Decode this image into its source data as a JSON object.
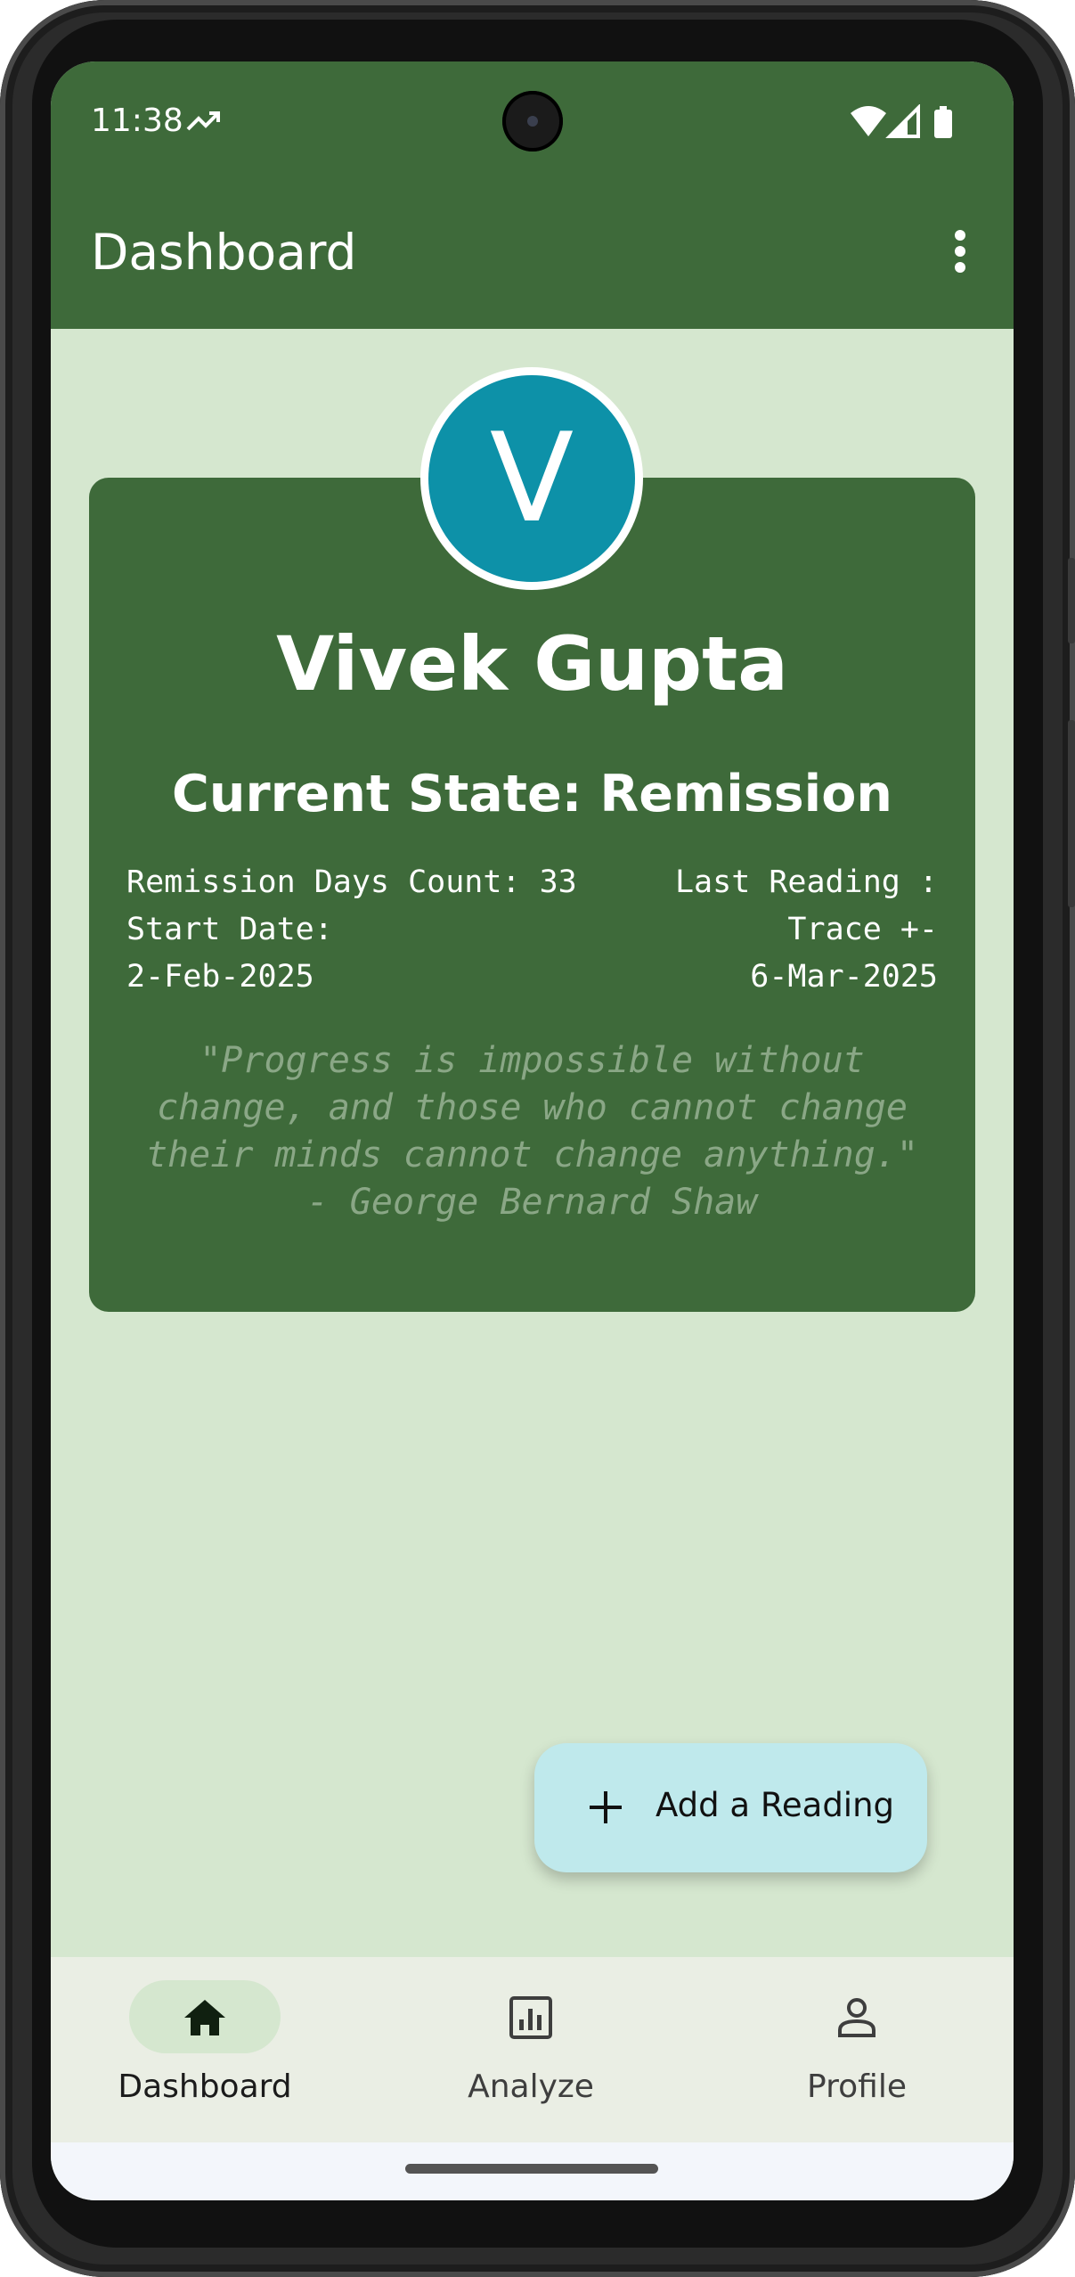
{
  "status_bar": {
    "time": "11:38"
  },
  "app_bar": {
    "title": "Dashboard"
  },
  "profile": {
    "avatar_initial": "V",
    "name": "Vivek Gupta",
    "current_state": "Current State: Remission",
    "left_info": [
      "Remission Days Count: 33",
      "Start Date:",
      "2-Feb-2025"
    ],
    "right_info": [
      "Last Reading :",
      "Trace +-",
      "6-Mar-2025"
    ],
    "quote": "\"Progress is impossible without change, and those who cannot change their minds cannot change anything.\" - George Bernard Shaw"
  },
  "fab": {
    "label": "Add a Reading",
    "icon": "plus-icon"
  },
  "bottom_nav": {
    "items": [
      {
        "label": "Dashboard",
        "icon": "home-icon",
        "active": true
      },
      {
        "label": "Analyze",
        "icon": "bar-chart-icon",
        "active": false
      },
      {
        "label": "Profile",
        "icon": "person-icon",
        "active": false
      }
    ]
  },
  "colors": {
    "primary": "#3e6a3a",
    "background": "#d5e7cf",
    "avatar": "#0d91a8",
    "fab": "#bfe9ec",
    "nav_background": "#eaeee4"
  }
}
